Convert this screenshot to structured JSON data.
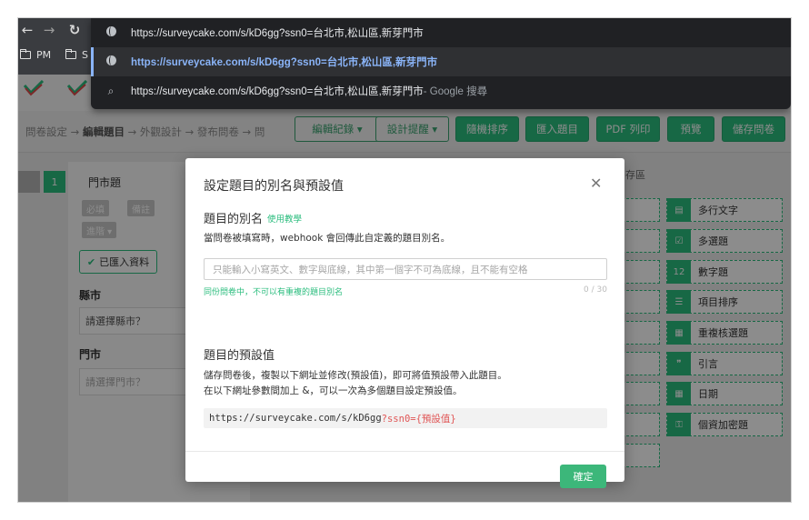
{
  "colors": {
    "accent": "#2bbd7e",
    "chrome_bg": "#3a3c40",
    "omnibox_bg": "#202124",
    "link_blue": "#8ab4f8",
    "param_red": "#e05555"
  },
  "browser": {
    "bookmarks": [
      "PM",
      "S"
    ],
    "suggestions": [
      {
        "icon": "globe-icon",
        "text": "https://surveycake.com/s/kD6gg?ssn0=台北市,松山區,新芽門市",
        "suffix": ""
      },
      {
        "icon": "globe-icon",
        "text": "https://surveycake.com/s/kD6gg?ssn0=台北市,松山區,新芽門市",
        "suffix": "",
        "selected": true
      },
      {
        "icon": "search-icon",
        "text": "https://surveycake.com/s/kD6gg?ssn0=台北市,松山區,新芽門市",
        "suffix": " - Google 搜尋"
      }
    ]
  },
  "toolbar": {
    "breadcrumb": [
      "問卷設定",
      "編輯題目",
      "外觀設計",
      "發布問卷",
      "問"
    ],
    "buttons": [
      "編輯紀錄 ▾",
      "設計提醒 ▾",
      "隨機排序",
      "匯入題目",
      "PDF 列印",
      "預覽",
      "儲存問卷"
    ]
  },
  "editor": {
    "question_number": "1",
    "question_title": "門市題",
    "tags": [
      "必填",
      "備註",
      "進階 ▾"
    ],
    "imported_label": "已匯入資料",
    "field1_label": "縣市",
    "field1_value": "請選擇縣市？",
    "field2_label": "門市",
    "field2_value": "請選擇門市？"
  },
  "palette": {
    "title": "存區",
    "items": [
      "多行文字",
      "多選題",
      "數字題",
      "項目排序",
      "重複核選題",
      "引言",
      "日期",
      "個資加密題"
    ]
  },
  "dialog": {
    "title": "設定題目的別名與預設值",
    "alias_heading": "題目的別名",
    "alias_tutorial_link": "使用教學",
    "alias_desc": "當問卷被填寫時，webhook 會回傳此自定義的題目別名。",
    "alias_placeholder": "只能輸入小寫英文、數字與底線，其中第一個字不可為底線，且不能有空格",
    "alias_hint": "同份問卷中，不可以有重複的題目別名",
    "alias_count": "0 / 30",
    "default_heading": "題目的預設值",
    "default_desc_1": "儲存問卷後，複製以下網址並修改(預設值)，即可將值預設帶入此題目。",
    "default_desc_2": "在以下網址參數間加上 &，可以一次為多個題目設定預設值。",
    "url_base": "https://surveycake.com/s/kD6gg",
    "url_param": "?ssn0={預設值}",
    "confirm_label": "確定"
  }
}
